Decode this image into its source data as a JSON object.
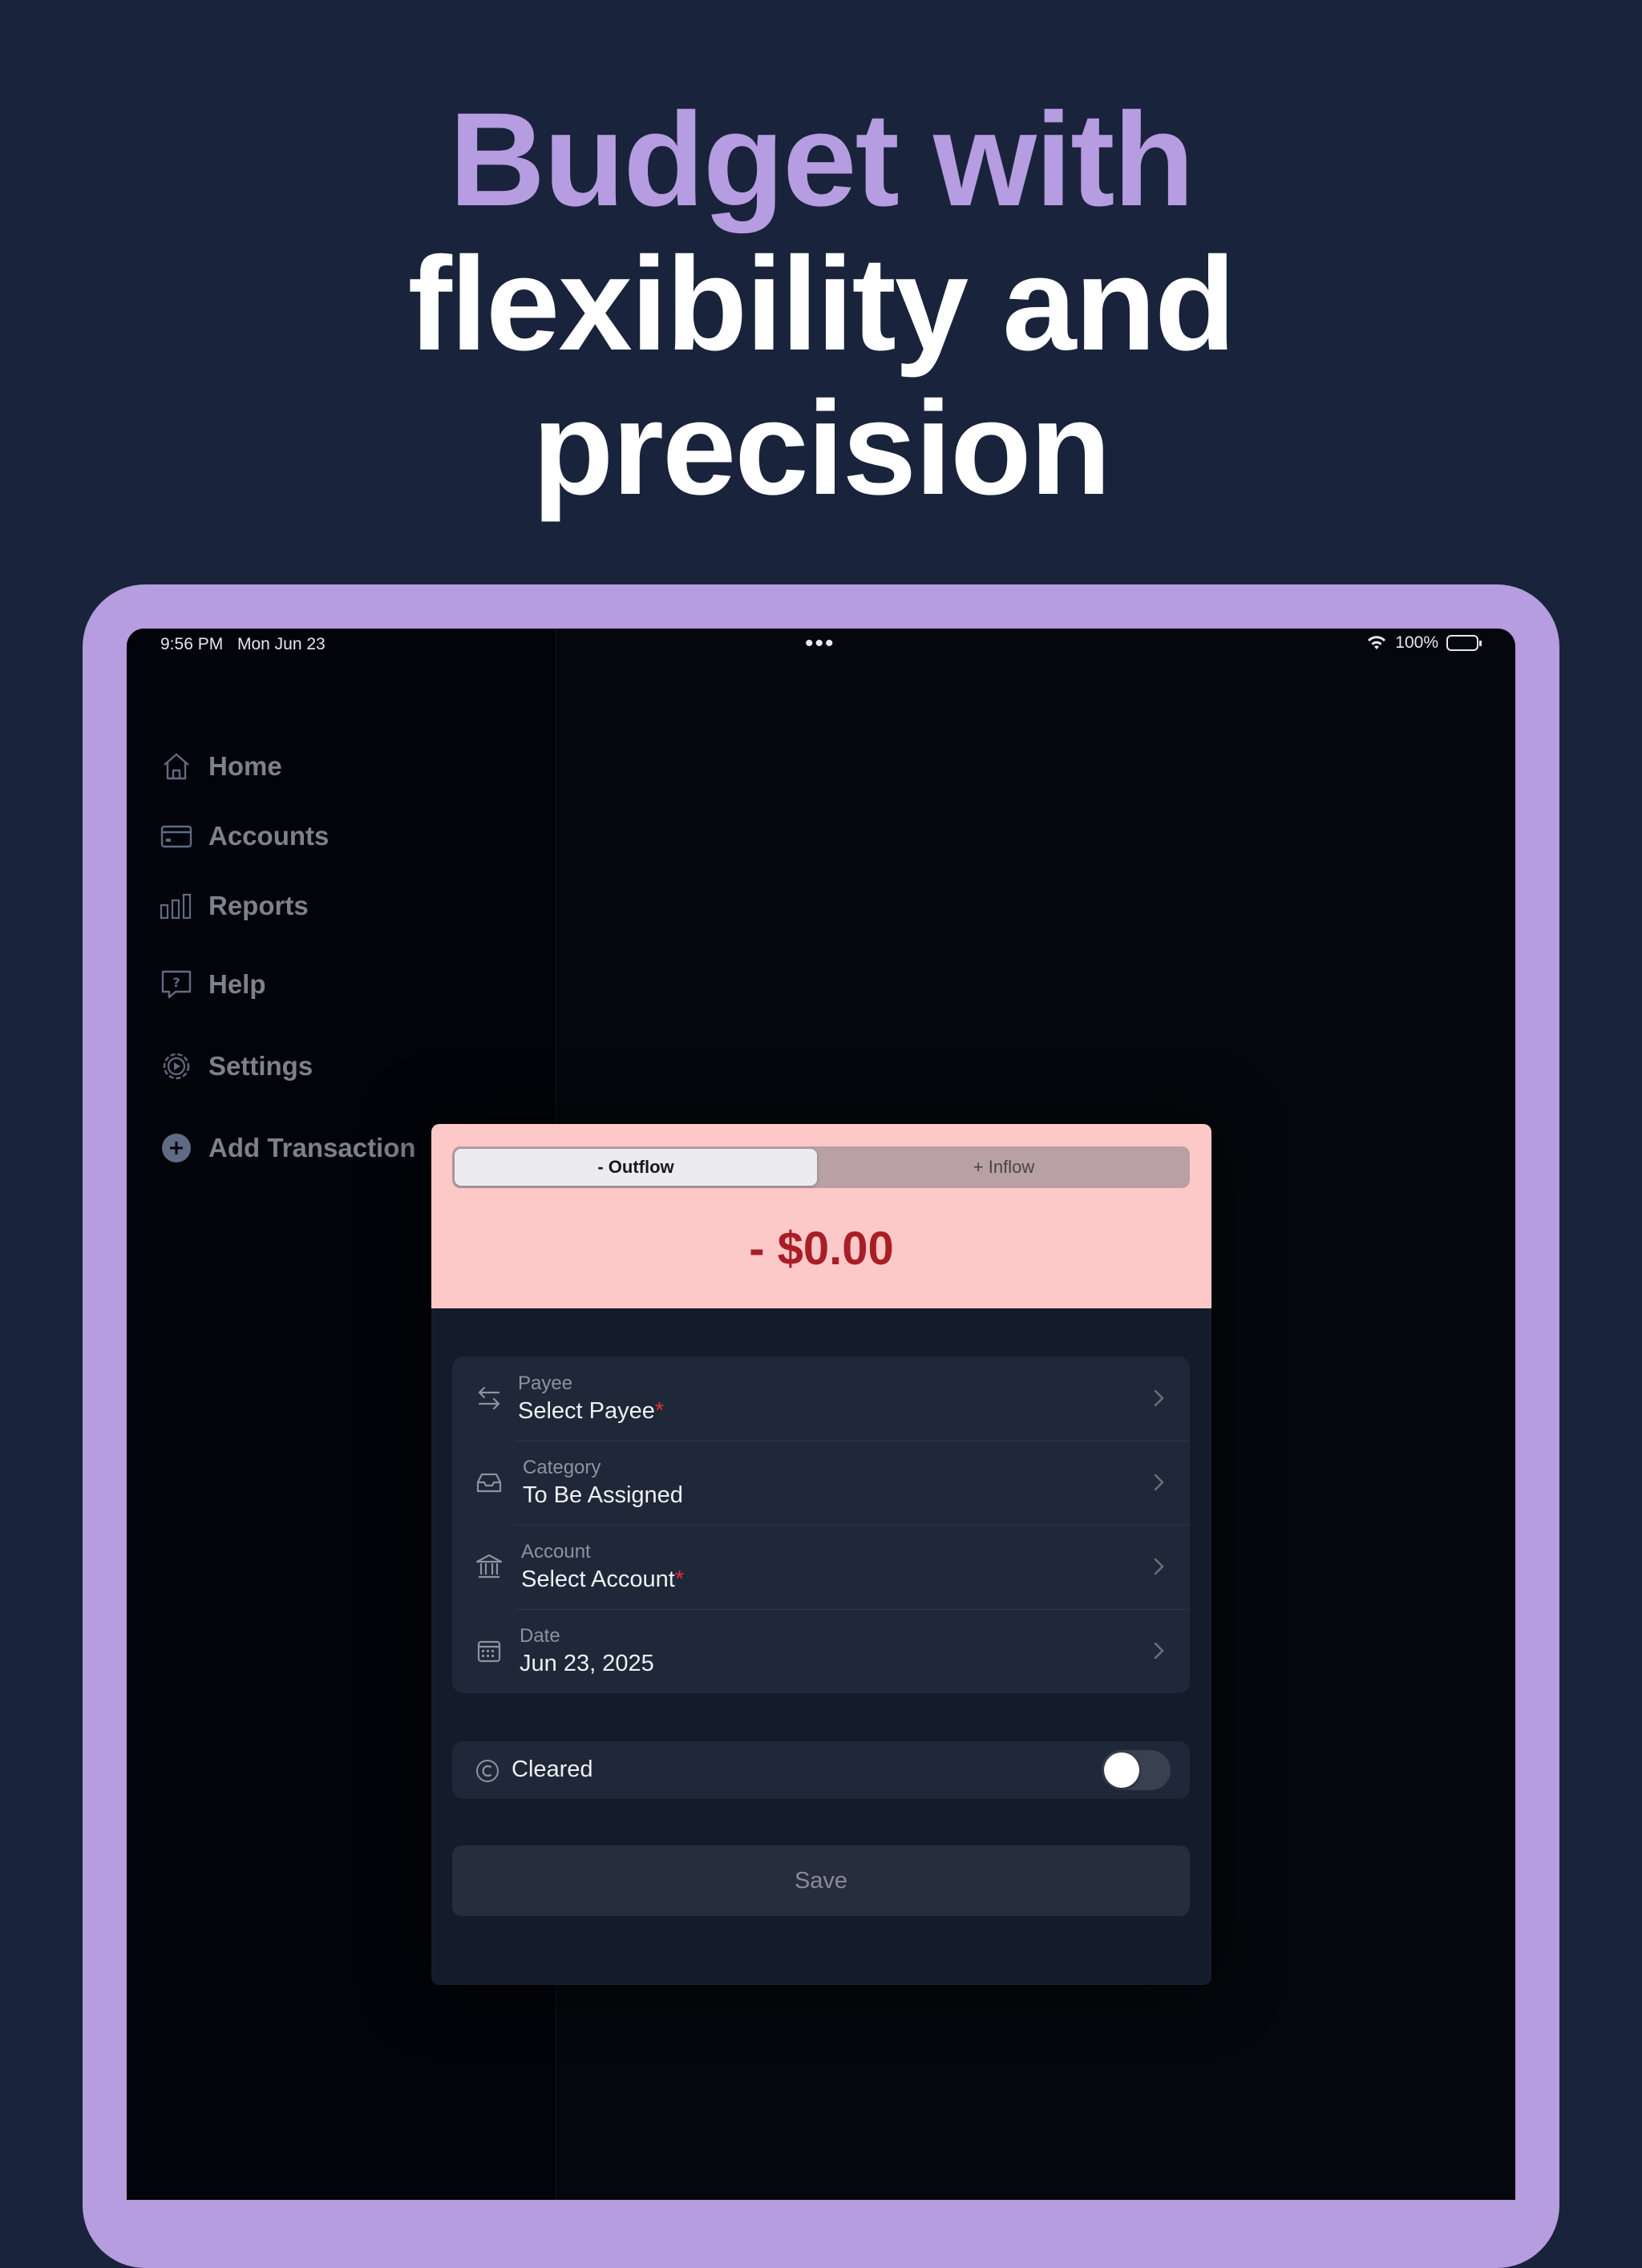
{
  "headline": {
    "line1": "Budget with",
    "line2": "flexibility and",
    "line3": "precision"
  },
  "status_bar": {
    "time": "9:56 PM",
    "date": "Mon Jun 23",
    "multitask": "•••",
    "battery": "100%",
    "icons": [
      "wifi-icon",
      "battery-icon"
    ]
  },
  "sidebar": {
    "items": [
      {
        "label": "Home",
        "icon": "home-icon"
      },
      {
        "label": "Accounts",
        "icon": "credit-card-icon"
      },
      {
        "label": "Reports",
        "icon": "bar-chart-icon"
      },
      {
        "label": "Help",
        "icon": "help-bubble-icon"
      },
      {
        "label": "Settings",
        "icon": "gear-icon"
      },
      {
        "label": "Add Transaction",
        "icon": "plus-circle-icon"
      }
    ]
  },
  "transaction": {
    "segment": {
      "outflow": "- Outflow",
      "inflow": "+ Inflow",
      "selected": "outflow"
    },
    "amount": "- $0.00",
    "fields": [
      {
        "label": "Payee",
        "value": "Select Payee",
        "required": "*",
        "icon": "swap-arrows-icon"
      },
      {
        "label": "Category",
        "value": "To Be Assigned",
        "required": "",
        "icon": "tray-icon"
      },
      {
        "label": "Account",
        "value": "Select Account",
        "required": "*",
        "icon": "bank-icon"
      },
      {
        "label": "Date",
        "value": "Jun 23, 2025",
        "required": "",
        "icon": "calendar-icon"
      }
    ],
    "cleared": {
      "label": "Cleared",
      "on": false,
      "icon": "copyright-c-icon"
    },
    "save_label": "Save"
  },
  "colors": {
    "background": "#19233b",
    "accent_purple": "#b69ce0",
    "amount_bg": "#fdc9c8",
    "amount_text": "#a81e26",
    "required": "#e0303a"
  }
}
